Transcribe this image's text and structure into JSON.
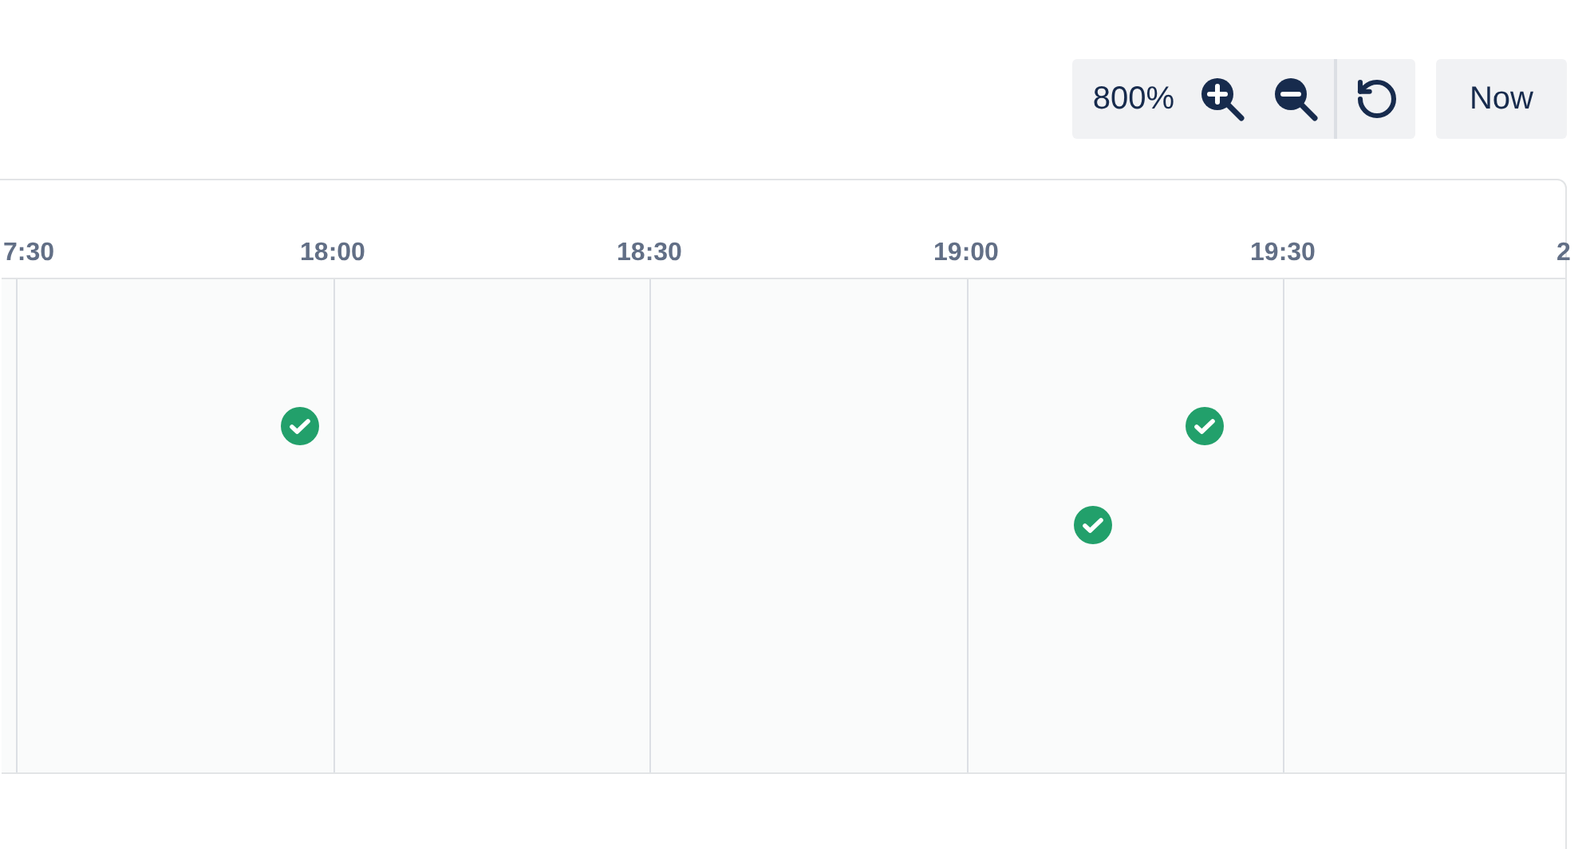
{
  "toolbar": {
    "zoom": "800%",
    "now_button": "Now"
  },
  "timeline": {
    "time_labels": [
      "7:30",
      "18:00",
      "18:30",
      "19:00",
      "19:30",
      "2"
    ],
    "events": [
      {
        "kind": "success"
      },
      {
        "kind": "success"
      },
      {
        "kind": "success"
      }
    ]
  }
}
